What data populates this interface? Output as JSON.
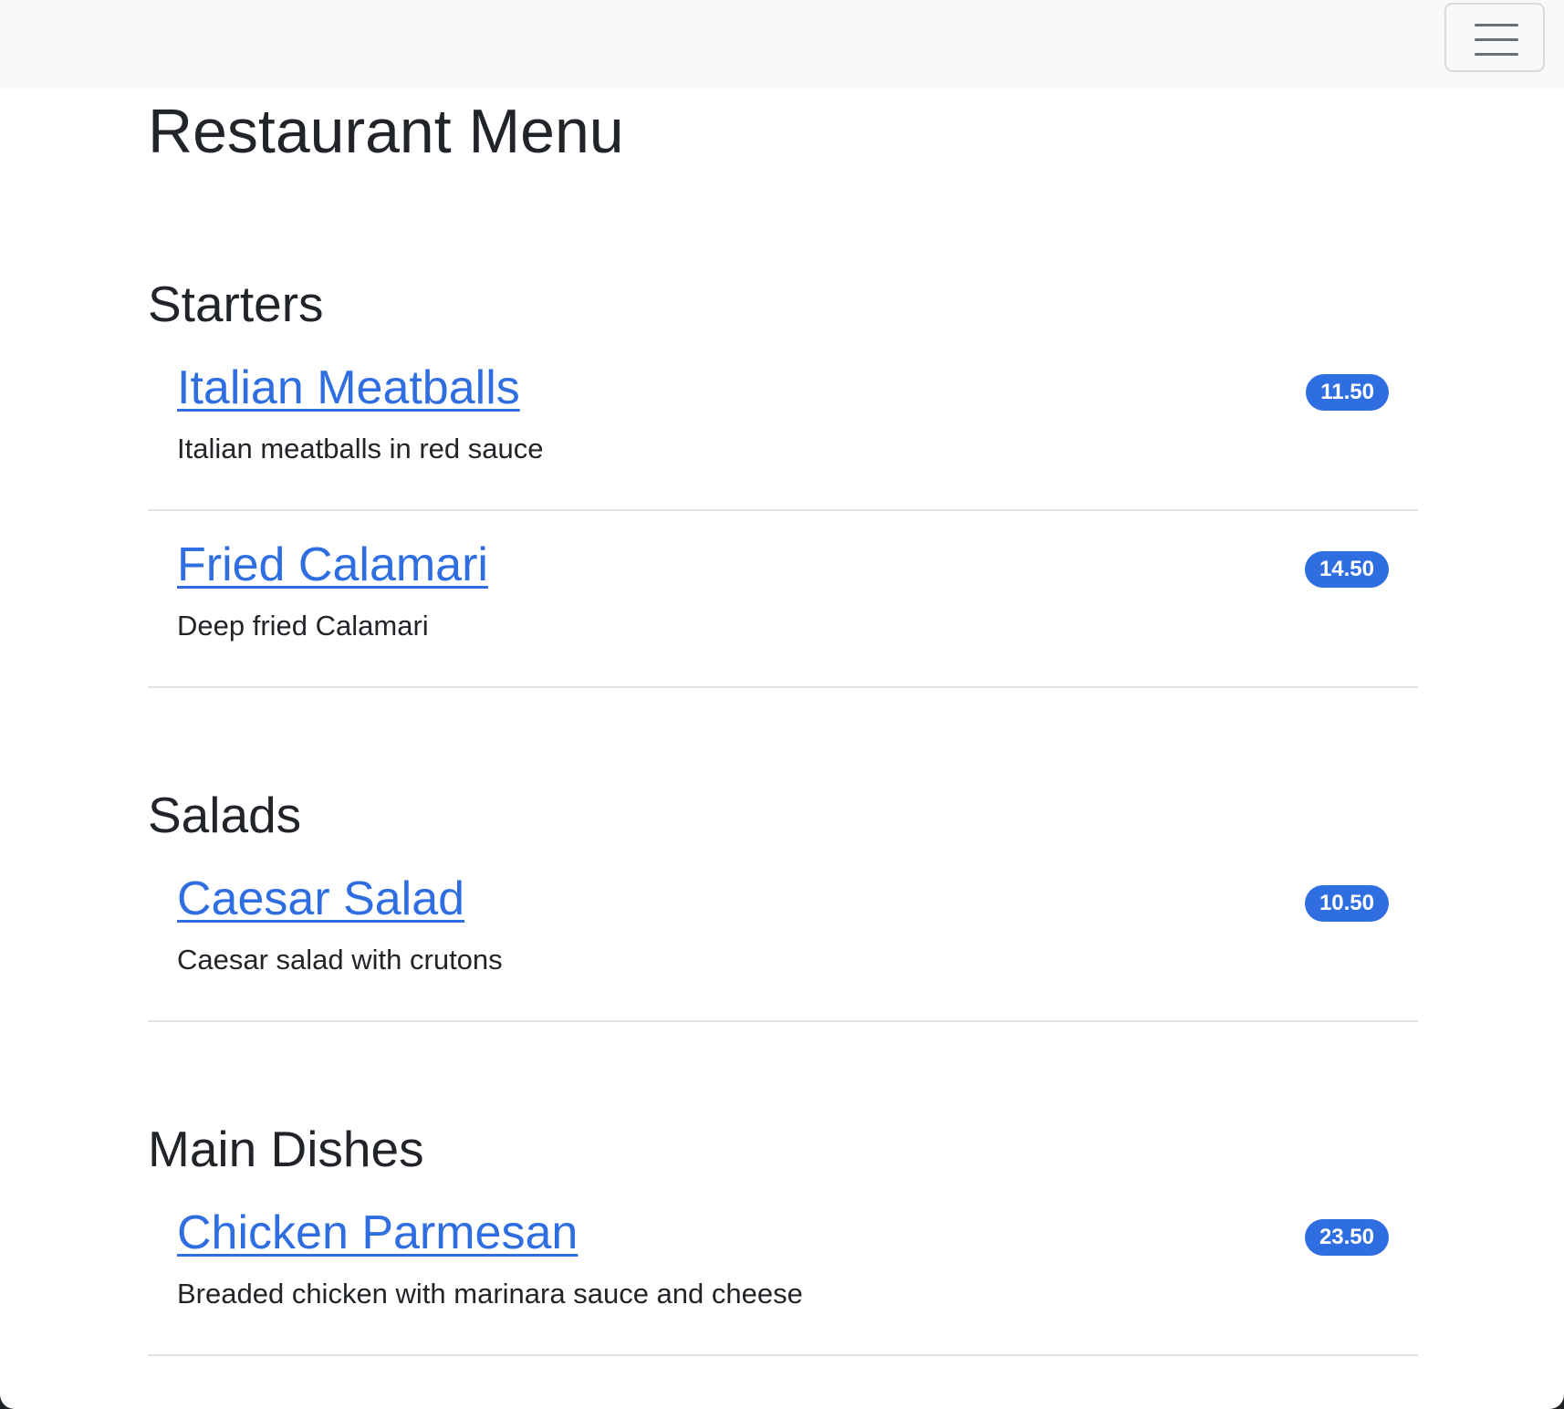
{
  "page": {
    "title": "Restaurant Menu"
  },
  "navbar": {
    "toggler_icon": "hamburger-icon"
  },
  "colors": {
    "accent": "#2f6ee0",
    "text": "#212529",
    "navbar_bg": "#f8f9fa",
    "divider": "#dee2e6"
  },
  "sections": [
    {
      "title": "Starters",
      "items": [
        {
          "name": "Italian Meatballs",
          "description": "Italian meatballs in red sauce",
          "price": "11.50"
        },
        {
          "name": "Fried Calamari",
          "description": "Deep fried Calamari",
          "price": "14.50"
        }
      ]
    },
    {
      "title": "Salads",
      "items": [
        {
          "name": "Caesar Salad",
          "description": "Caesar salad with crutons",
          "price": "10.50"
        }
      ]
    },
    {
      "title": "Main Dishes",
      "items": [
        {
          "name": "Chicken Parmesan",
          "description": "Breaded chicken with marinara sauce and cheese",
          "price": "23.50"
        }
      ]
    }
  ]
}
